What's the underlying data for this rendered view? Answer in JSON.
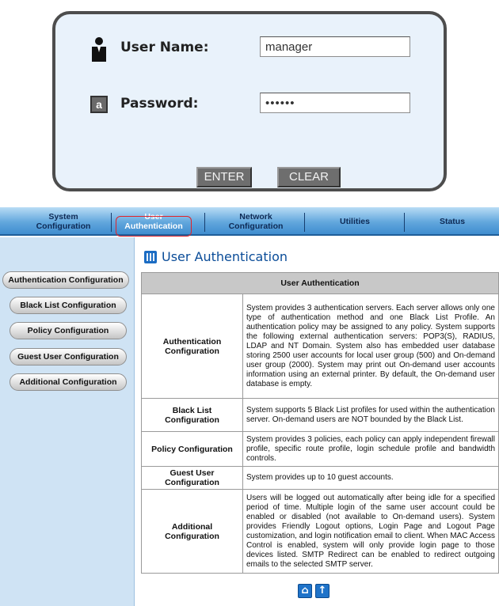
{
  "login": {
    "username_label": "User Name:",
    "username_value": "manager",
    "password_label": "Password:",
    "password_value": "••••••",
    "enter_label": "ENTER",
    "clear_label": "CLEAR"
  },
  "topnav": {
    "items": [
      {
        "line1": "System",
        "line2": "Configuration"
      },
      {
        "line1": "User",
        "line2": "Authentication"
      },
      {
        "line1": "Network",
        "line2": "Configuration"
      },
      {
        "line1": "Utilities",
        "line2": ""
      },
      {
        "line1": "Status",
        "line2": ""
      }
    ],
    "active_index": 1,
    "highlight_color": "#e0242a"
  },
  "sidebar": {
    "items": [
      {
        "label": "Authentication Configuration"
      },
      {
        "label": "Black List Configuration"
      },
      {
        "label": "Policy Configuration"
      },
      {
        "label": "Guest User Configuration"
      },
      {
        "label": "Additional Configuration"
      }
    ]
  },
  "main": {
    "title": "User Authentication",
    "table": {
      "header": "User Authentication",
      "rows": [
        {
          "name": "Authentication Configuration",
          "desc": "System provides 3 authentication servers. Each server allows only one type of authentication method and one Black List Profile. An authentication policy may be assigned to any policy. System supports the following external authentication servers: POP3(S), RADIUS, LDAP and NT Domain. System also has embedded user database storing 2500 user accounts for local user group (500) and On-demand user group (2000). System may print out On-demand user accounts information using an external printer. By default, the On-demand user database is empty."
        },
        {
          "name": "Black List Configuration",
          "desc": "System supports 5 Black List profiles for used within the authentication server. On-demand users are NOT bounded by the Black List."
        },
        {
          "name": "Policy Configuration",
          "desc": "System provides 3 policies, each policy can apply independent firewall profile, specific route profile, login schedule profile and bandwidth controls."
        },
        {
          "name": "Guest User Configuration",
          "desc": "System provides up to 10 guest accounts."
        },
        {
          "name": "Additional Configuration",
          "desc": "Users will be logged out automatically after being idle for a specified period of time. Multiple login of the same user account could be enabled or disabled (not available to On-demand users). System provides Friendly Logout options, Login Page and Logout Page customization, and login notification email to client. When MAC Access Control is enabled, system will only provide login page to those devices listed. SMTP Redirect can be enabled to redirect outgoing emails to the selected SMTP server."
        }
      ]
    },
    "footer_icons": [
      "home-icon",
      "up-arrow-icon"
    ]
  }
}
